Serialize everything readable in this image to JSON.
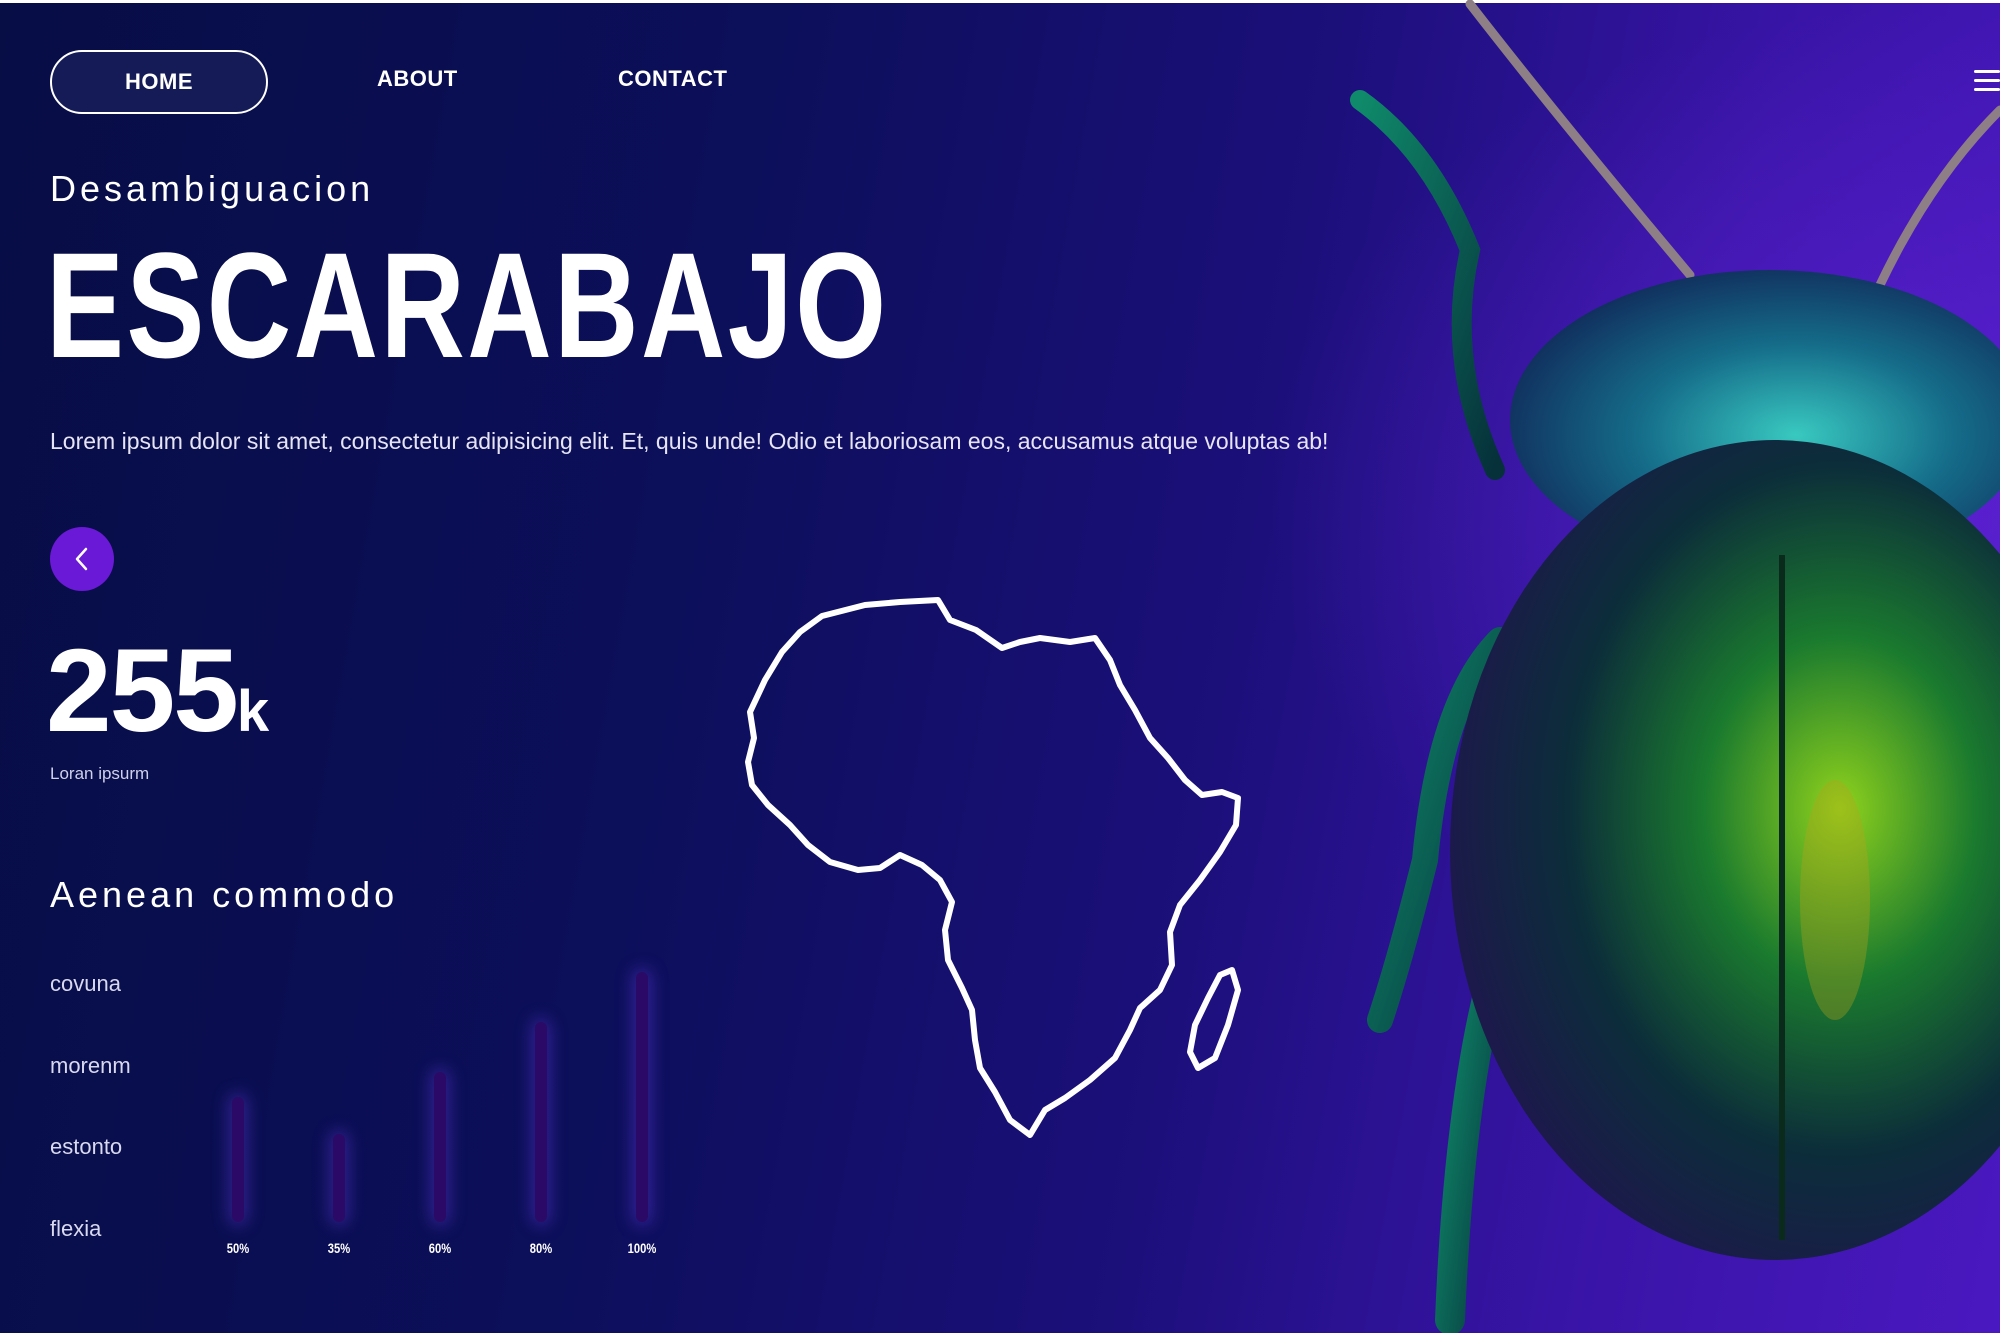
{
  "nav": {
    "items": [
      {
        "label": "HOME",
        "active": true
      },
      {
        "label": "ABOUT"
      },
      {
        "label": "CONTACT"
      }
    ]
  },
  "hero": {
    "subtitle": "Desambiguacion",
    "title": "ESCARABAJO",
    "description": "Lorem ipsum dolor sit amet, consectetur adipisicing elit. Et, quis unde! Odio et laboriosam eos, accusamus atque voluptas ab!"
  },
  "stat": {
    "value": "255",
    "unit": "k",
    "label": "Loran ipsurm"
  },
  "section": {
    "heading": "Aenean commodo",
    "rows": [
      "covuna",
      "morenm",
      "estonto",
      "flexia"
    ]
  },
  "chart_data": {
    "type": "bar",
    "categories": [
      "50%",
      "35%",
      "60%",
      "80%",
      "100%"
    ],
    "values": [
      50,
      35,
      60,
      80,
      100
    ],
    "ylim": [
      0,
      100
    ]
  },
  "icons": {
    "back": "chevron-left-icon",
    "menu": "hamburger-menu-icon",
    "map": "africa-map-outline",
    "image": "beetle-image"
  },
  "colors": {
    "background_dark": "#070d45",
    "background_purple": "#4a18c0",
    "accent": "#6a19d6",
    "bar": "#2a0a66"
  }
}
